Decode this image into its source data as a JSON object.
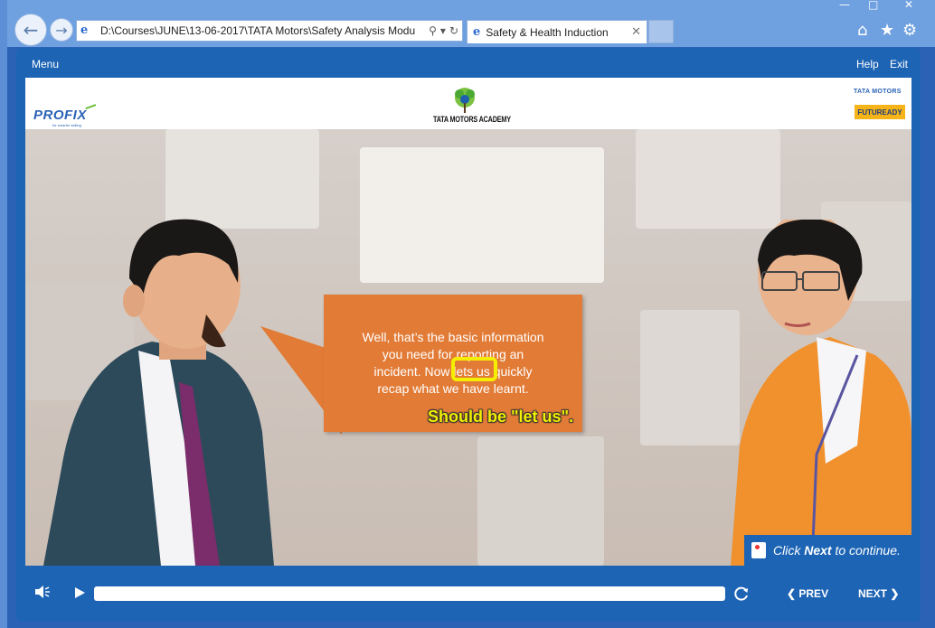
{
  "browser": {
    "address": "D:\\Courses\\JUNE\\13-06-2017\\TATA Motors\\Safety Analysis Modu",
    "tab_title": "Safety & Health Induction",
    "icons": [
      "back-arrow-icon",
      "forward-arrow-icon",
      "search-icon",
      "refresh-icon",
      "home-icon",
      "star-icon",
      "gear-icon"
    ]
  },
  "player": {
    "menu_label": "Menu",
    "help_label": "Help",
    "exit_label": "Exit"
  },
  "header": {
    "profix_logo": "PROFIX",
    "profix_tagline": "for smarter selling",
    "academy_name": "TATA MOTORS ACADEMY",
    "tata_motors": "TATA MOTORS",
    "futuready": "FUTUREADY"
  },
  "speech": {
    "line1": "Well, that’s the basic information",
    "line2": "you need for reporting an",
    "line3": "incident. Now lets us quickly",
    "line4": "recap what we have learnt."
  },
  "annotation": {
    "text": "Should be \"let us\".",
    "highlight_color": "#f4ee00"
  },
  "click_next": {
    "prefix": "Click ",
    "bold": "Next",
    "suffix": " to continue."
  },
  "controls": {
    "prev_label": "PREV",
    "next_label": "NEXT",
    "progress": 0
  },
  "colors": {
    "player_blue": "#1d64b4",
    "speech_orange": "#e27b36"
  }
}
